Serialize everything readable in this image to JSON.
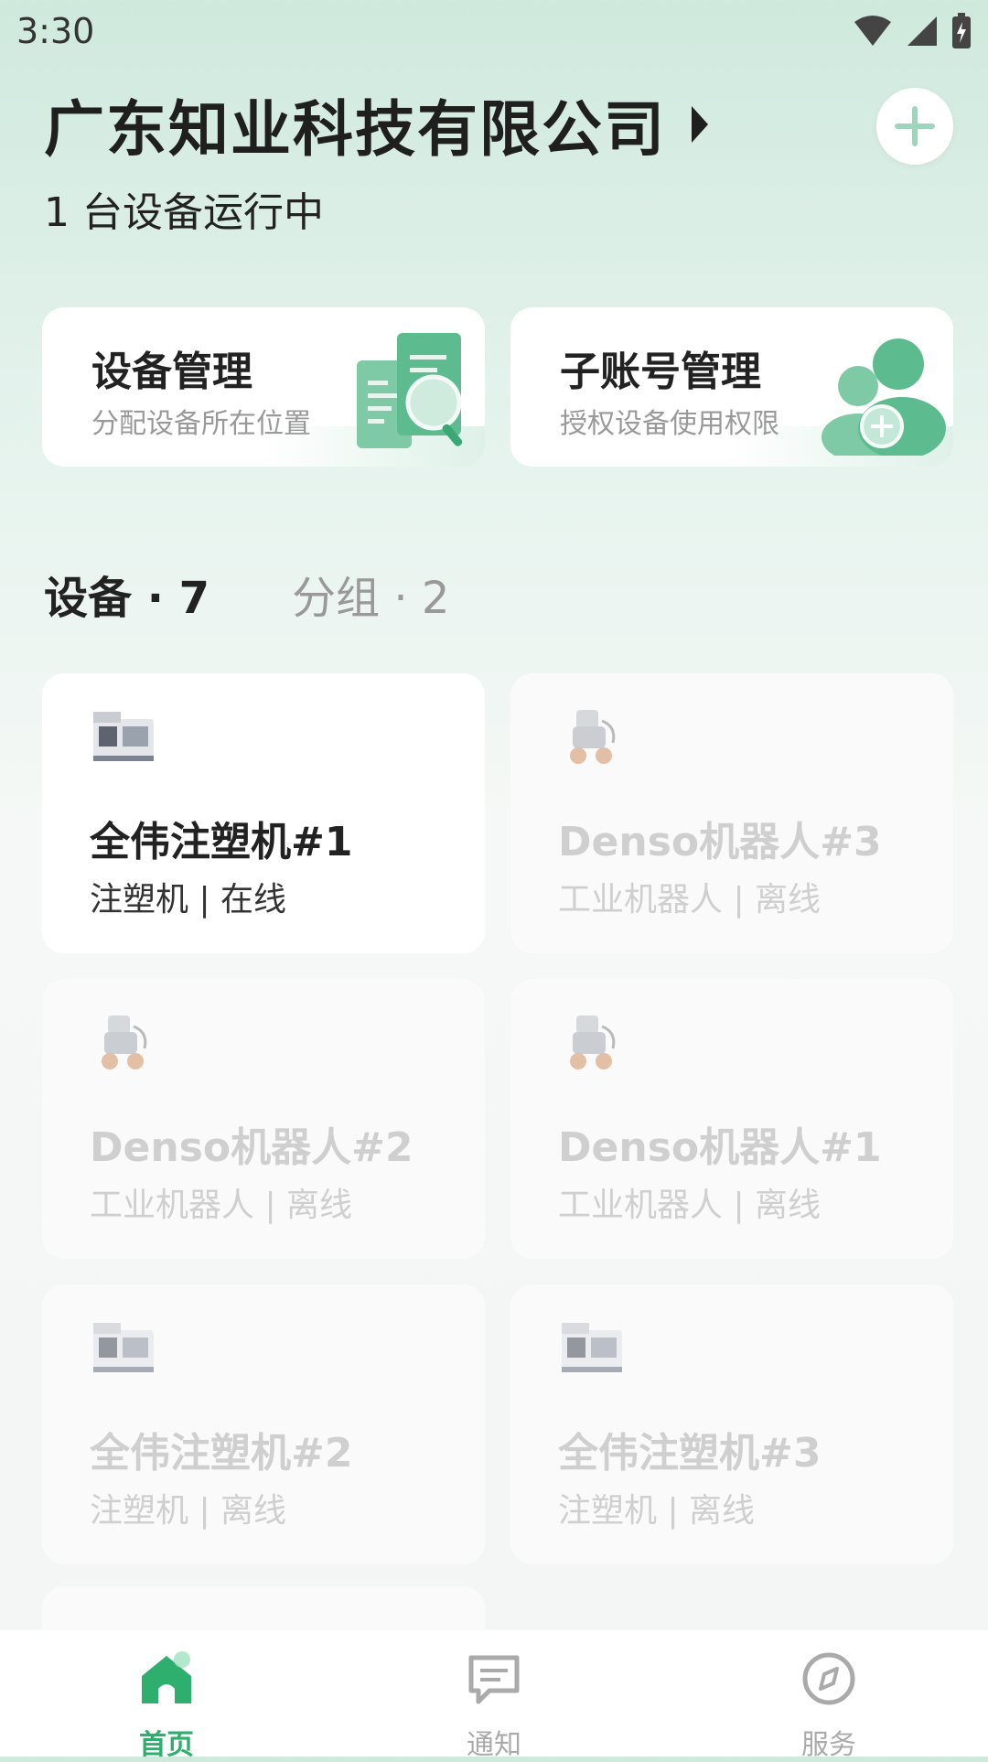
{
  "status_bar": {
    "time": "3:30"
  },
  "header": {
    "company_name": "广东知业科技有限公司",
    "running_text": "1 台设备运行中"
  },
  "feature_cards": [
    {
      "title": "设备管理",
      "subtitle": "分配设备所在位置"
    },
    {
      "title": "子账号管理",
      "subtitle": "授权设备使用权限"
    }
  ],
  "tabs": {
    "devices": "设备 · 7",
    "groups": "分组 · 2"
  },
  "devices": [
    {
      "name": "全伟注塑机#1",
      "type": "注塑机",
      "status": "在线",
      "meta": "注塑机 | 在线",
      "icon": "injection-machine-icon"
    },
    {
      "name": "Denso机器人#3",
      "type": "工业机器人",
      "status": "离线",
      "meta": "工业机器人 | 离线",
      "icon": "robot-icon"
    },
    {
      "name": "Denso机器人#2",
      "type": "工业机器人",
      "status": "离线",
      "meta": "工业机器人 | 离线",
      "icon": "robot-icon"
    },
    {
      "name": "Denso机器人#1",
      "type": "工业机器人",
      "status": "离线",
      "meta": "工业机器人 | 离线",
      "icon": "robot-icon"
    },
    {
      "name": "全伟注塑机#2",
      "type": "注塑机",
      "status": "离线",
      "meta": "注塑机 | 离线",
      "icon": "injection-machine-icon"
    },
    {
      "name": "全伟注塑机#3",
      "type": "注塑机",
      "status": "离线",
      "meta": "注塑机 | 离线",
      "icon": "injection-machine-icon"
    }
  ],
  "bottom_nav": [
    {
      "label": "首页",
      "icon": "home-icon",
      "active": true
    },
    {
      "label": "通知",
      "icon": "message-icon",
      "active": false
    },
    {
      "label": "服务",
      "icon": "compass-icon",
      "active": false
    }
  ],
  "colors": {
    "accent": "#2faf6e",
    "mint": "#9fd5bd"
  }
}
